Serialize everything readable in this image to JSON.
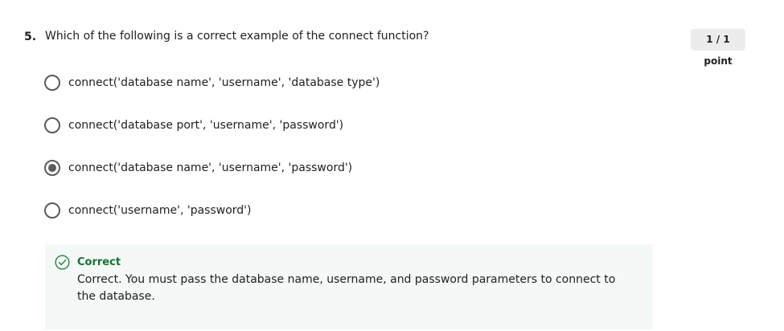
{
  "question": {
    "number": "5.",
    "text": "Which of the following is a correct example of the connect function?",
    "points": "1 / 1 point"
  },
  "options": [
    {
      "label": "connect('database name', 'username', 'database type')",
      "selected": false
    },
    {
      "label": "connect('database port', 'username', 'password')",
      "selected": false
    },
    {
      "label": "connect('database name', 'username', 'password')",
      "selected": true
    },
    {
      "label": "connect('username', 'password')",
      "selected": false
    }
  ],
  "feedback": {
    "title": "Correct",
    "text": "Correct. You must pass the database name, username, and password parameters to connect to the database.",
    "icon": "check-circle-icon"
  },
  "colors": {
    "correct_green": "#137333",
    "feedback_bg": "#f4f8f6",
    "radio_gray": "#5b5b5b",
    "badge_bg": "#ececec"
  }
}
